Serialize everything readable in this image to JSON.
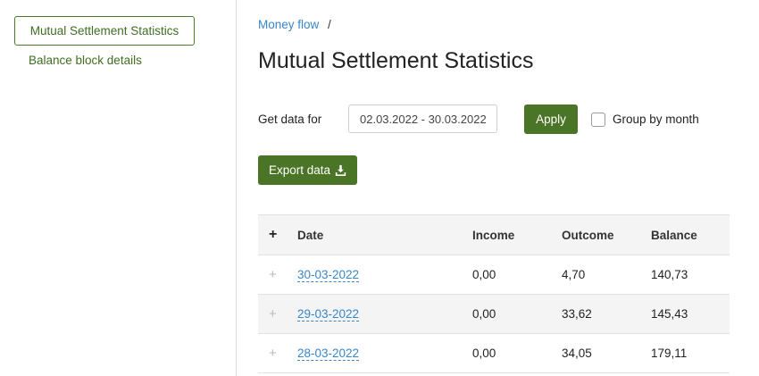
{
  "sidebar": {
    "active_item": "Mutual Settlement Statistics",
    "items": [
      "Balance block details"
    ]
  },
  "breadcrumb": {
    "link": "Money flow",
    "separator": "/"
  },
  "page_title": "Mutual Settlement Statistics",
  "filter": {
    "label": "Get data for",
    "date_range": "02.03.2022 - 30.03.2022",
    "apply_label": "Apply",
    "group_by_month_label": "Group by month",
    "group_by_month_checked": false
  },
  "export": {
    "label": "Export data",
    "icon": "download-icon"
  },
  "table": {
    "expand_all": "+",
    "headers": {
      "date": "Date",
      "income": "Income",
      "outcome": "Outcome",
      "balance": "Balance"
    },
    "rows": [
      {
        "expand": "+",
        "date": "30-03-2022",
        "income": "0,00",
        "outcome": "4,70",
        "balance": "140,73"
      },
      {
        "expand": "+",
        "date": "29-03-2022",
        "income": "0,00",
        "outcome": "33,62",
        "balance": "145,43"
      },
      {
        "expand": "+",
        "date": "28-03-2022",
        "income": "0,00",
        "outcome": "34,05",
        "balance": "179,11"
      }
    ]
  },
  "colors": {
    "accent_green": "#4a7527",
    "link_blue": "#3a86c8"
  }
}
